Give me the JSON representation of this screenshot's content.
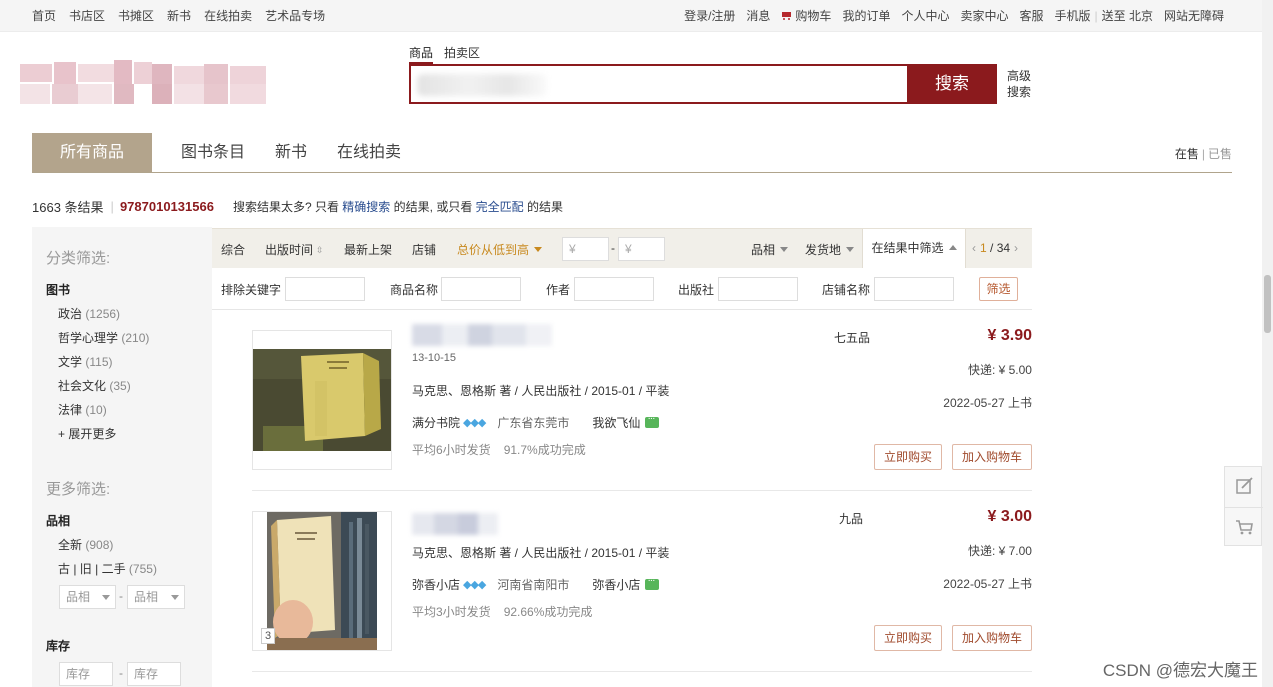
{
  "topbar": {
    "left": [
      "首页",
      "书店区",
      "书摊区",
      "新书",
      "在线拍卖",
      "艺术品专场"
    ],
    "login": "登录/注册",
    "message": "消息",
    "cart": "购物车",
    "orders": "我的订单",
    "personal": "个人中心",
    "seller": "卖家中心",
    "service": "客服",
    "mobile": "手机版",
    "deliver": "送至 北京",
    "accessible": "网站无障碍"
  },
  "search": {
    "tab_goods": "商品",
    "tab_auction": "拍卖区",
    "button": "搜索",
    "advanced": "高级搜索"
  },
  "maintabs": {
    "all": "所有商品",
    "book_entry": "图书条目",
    "new_book": "新书",
    "auction": "在线拍卖",
    "on_sale": "在售",
    "sold": "已售"
  },
  "results_info": {
    "count": "1663 条结果",
    "isbn": "9787010131566",
    "tip_prefix": "搜索结果太多? 只看",
    "exact": "精确搜索",
    "tip_mid": "的结果, 或只看",
    "full_match": "完全匹配",
    "tip_suffix": "的结果"
  },
  "sidebar": {
    "category_title": "分类筛选:",
    "group_books": "图书",
    "categories": [
      {
        "label": "政治",
        "count": "(1256)"
      },
      {
        "label": "哲学心理学",
        "count": "(210)"
      },
      {
        "label": "文学",
        "count": "(115)"
      },
      {
        "label": "社会文化",
        "count": "(35)"
      },
      {
        "label": "法律",
        "count": "(10)"
      }
    ],
    "expand_more": "+ 展开更多",
    "more_title": "更多筛选:",
    "group_condition": "品相",
    "conditions": [
      {
        "label": "全新",
        "count": "(908)"
      },
      {
        "label": "古 | 旧 | 二手",
        "count": "(755)"
      }
    ],
    "cond_select": "品相",
    "group_stock": "库存",
    "stock_placeholder": "库存"
  },
  "sortbar": {
    "comprehensive": "综合",
    "pub_time": "出版时间",
    "newest": "最新上架",
    "shop": "店铺",
    "price_low_high": "总价从低到高",
    "price_placeholder": "¥",
    "condition": "品相",
    "ship_from": "发货地",
    "filter_in_results": "在结果中筛选",
    "page_current": "1",
    "page_total": "/ 34"
  },
  "filterrow": {
    "exclude": "排除关键字",
    "product_name": "商品名称",
    "author": "作者",
    "publisher": "出版社",
    "shop_name": "店铺名称",
    "button": "筛选"
  },
  "results": [
    {
      "date_snippet": "13-10-15",
      "author_line": "马克思、恩格斯 著 / 人民出版社 / 2015-01 / 平装",
      "shop": "满分书院",
      "gems": "💎💎💎",
      "location": "广东省东莞市",
      "seller": "我欲飞仙",
      "ship_time": "平均6小时发货",
      "success_rate": "91.7%成功完成",
      "condition": "七五品",
      "price": "¥ 3.90",
      "shipping_fee": "快递: ¥ 5.00",
      "listed": "2022-05-27 上书",
      "buy": "立即购买",
      "add_cart": "加入购物车"
    },
    {
      "author_line": "马克思、恩格斯 著 / 人民出版社 / 2015-01 / 平装",
      "shop": "弥香小店",
      "gems": "💎💎💎",
      "location": "河南省南阳市",
      "seller": "弥香小店",
      "ship_time": "平均3小时发货",
      "success_rate": "92.66%成功完成",
      "condition": "九品",
      "price": "¥ 3.00",
      "shipping_fee": "快递: ¥ 7.00",
      "listed": "2022-05-27 上书",
      "buy": "立即购买",
      "add_cart": "加入购物车",
      "image_count": "3"
    }
  ],
  "watermark": "CSDN @德宏大魔王",
  "colors": {
    "brand": "#8b1a1d",
    "tab_active": "#b3a48c",
    "sort_active": "#c8891e"
  }
}
